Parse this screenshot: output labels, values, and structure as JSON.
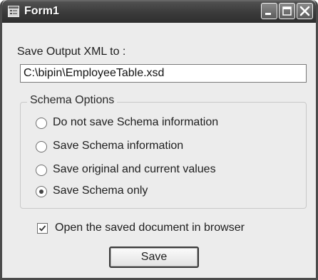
{
  "window": {
    "title": "Form1",
    "controls": [
      "minimize-icon",
      "maximize-icon",
      "close-icon"
    ]
  },
  "output": {
    "label": "Save Output XML to :",
    "path_value": "C:\\bipin\\EmployeeTable.xsd"
  },
  "schema_options": {
    "title": "Schema Options",
    "options": [
      {
        "label": "Do not save Schema information",
        "selected": false
      },
      {
        "label": "Save Schema information",
        "selected": false
      },
      {
        "label": "Save original and current values",
        "selected": false
      },
      {
        "label": "Save Schema only",
        "selected": true
      }
    ]
  },
  "open_in_browser": {
    "label": "Open the saved document in browser",
    "checked": true
  },
  "save_button": {
    "label": "Save"
  }
}
